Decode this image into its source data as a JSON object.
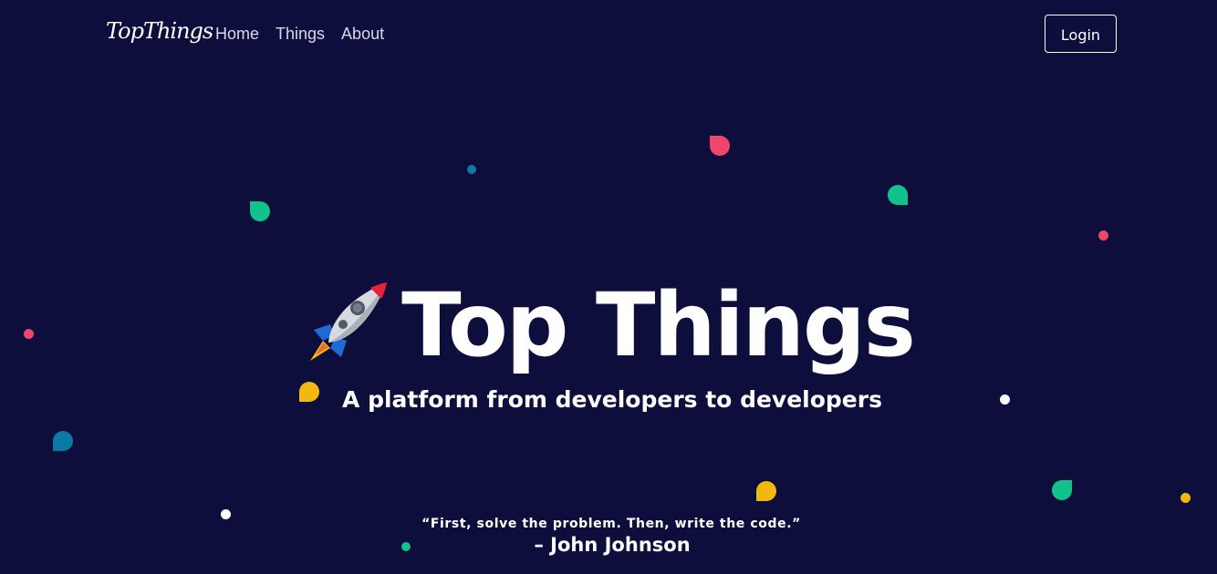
{
  "navbar": {
    "brand": "TopThings",
    "links": [
      "Home",
      "Things",
      "About"
    ],
    "login_label": "Login"
  },
  "hero": {
    "icon": "rocket-icon",
    "title": "Top Things",
    "subtitle": "A platform from developers to developers",
    "quote": "“First, solve the problem. Then, write the code.”",
    "author": "– John Johnson"
  },
  "colors": {
    "background": "#0e0e3d",
    "text": "#ffffff",
    "pink": "#f0466a",
    "green": "#11c38a",
    "yellow": "#f1b90f",
    "teal": "#0b7aa5",
    "white": "#ffffff"
  }
}
